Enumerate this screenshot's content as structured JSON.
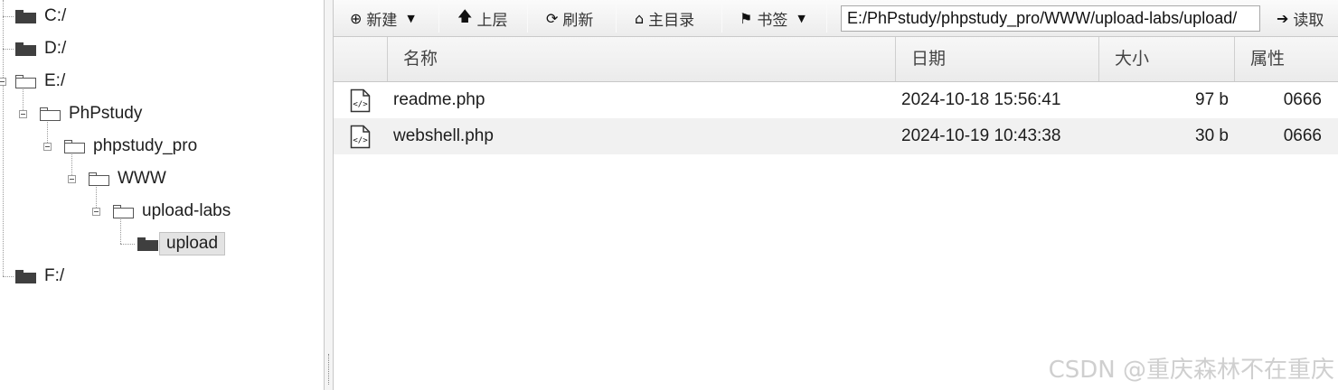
{
  "tree": {
    "nodes": [
      {
        "label": "C:/",
        "icon": "folder-filled-icon"
      },
      {
        "label": "D:/",
        "icon": "folder-filled-icon"
      },
      {
        "label": "E:/",
        "icon": "folder-open-icon"
      },
      {
        "label": "PhPstudy",
        "icon": "folder-open-icon"
      },
      {
        "label": "phpstudy_pro",
        "icon": "folder-open-icon"
      },
      {
        "label": "WWW",
        "icon": "folder-open-icon"
      },
      {
        "label": "upload-labs",
        "icon": "folder-open-icon"
      },
      {
        "label": "upload",
        "icon": "folder-filled-icon",
        "selected": true
      },
      {
        "label": "F:/",
        "icon": "folder-filled-icon"
      }
    ]
  },
  "toolbar": {
    "new_label": "新建",
    "up_label": "上层",
    "refresh_label": "刷新",
    "home_label": "主目录",
    "bookmark_label": "书签",
    "path_value": "E:/PhPstudy/phpstudy_pro/WWW/upload-labs/upload/",
    "read_label": "读取"
  },
  "table": {
    "headers": {
      "name": "名称",
      "date": "日期",
      "size": "大小",
      "attr": "属性"
    },
    "rows": [
      {
        "icon": "php-file-icon",
        "name": "readme.php",
        "date": "2024-10-18 15:56:41",
        "size": "97 b",
        "attr": "0666"
      },
      {
        "icon": "php-file-icon",
        "name": "webshell.php",
        "date": "2024-10-19 10:43:38",
        "size": "30 b",
        "attr": "0666"
      }
    ]
  },
  "watermark": "CSDN @重庆森林不在重庆"
}
